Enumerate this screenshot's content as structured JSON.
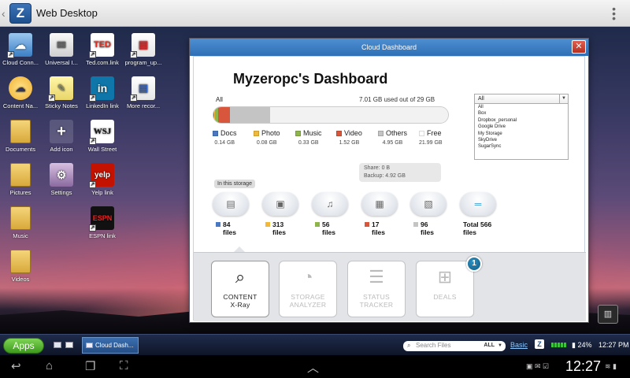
{
  "appbar": {
    "logo": "Z",
    "title": "Web Desktop",
    "overflow_icon": "overflow-menu-icon"
  },
  "desktop_icons": [
    {
      "label": "Cloud Conn...",
      "icon": "cloud-connect-icon"
    },
    {
      "label": "Universal I...",
      "icon": "universal-inbox-icon"
    },
    {
      "label": "Ted.com.link",
      "icon": "ted-link-icon",
      "text": "TED"
    },
    {
      "label": "program_up...",
      "icon": "document-icon"
    },
    {
      "label": "Content Na...",
      "icon": "content-navigator-icon"
    },
    {
      "label": "Sticky Notes",
      "icon": "sticky-notes-icon"
    },
    {
      "label": "LinkedIn link",
      "icon": "linkedin-icon",
      "text": "in"
    },
    {
      "label": "More recor...",
      "icon": "document-icon"
    },
    {
      "label": "Documents",
      "icon": "folder-icon"
    },
    {
      "label": "Add icon",
      "icon": "add-icon",
      "text": "+"
    },
    {
      "label": "Wall Street",
      "icon": "wsj-icon",
      "text": "WSJ"
    },
    {
      "label": "Pictures",
      "icon": "folder-icon"
    },
    {
      "label": "Settings",
      "icon": "settings-icon"
    },
    {
      "label": "Yelp link",
      "icon": "yelp-icon",
      "text": "yelp"
    },
    {
      "label": "Music",
      "icon": "folder-icon"
    },
    {
      "label": "ESPN link",
      "icon": "espn-icon",
      "text": "ESPN"
    },
    {
      "label": "Videos",
      "icon": "folder-icon"
    }
  ],
  "window": {
    "title": "Cloud Dashboard",
    "close_label": "✕",
    "heading": "Myzeropc's Dashboard",
    "scope_label": "All",
    "usage_text": "7.01 GB used out of 29 GB",
    "usage_bar": [
      {
        "name": "Docs",
        "fraction": 0.0048,
        "color": "#4a78c2"
      },
      {
        "name": "Photo",
        "fraction": 0.0028,
        "color": "#f0b93a"
      },
      {
        "name": "Music",
        "fraction": 0.0114,
        "color": "#8db54a"
      },
      {
        "name": "Video",
        "fraction": 0.0524,
        "color": "#d8573c"
      },
      {
        "name": "Others",
        "fraction": 0.1707,
        "color": "#c4c4c4"
      },
      {
        "name": "Free",
        "fraction": 0.7579,
        "color": "#f2f2f2"
      }
    ],
    "legend": [
      {
        "name": "Docs",
        "size": "0.14 GB",
        "color": "#4a78c2"
      },
      {
        "name": "Photo",
        "size": "0.08 GB",
        "color": "#f0b93a"
      },
      {
        "name": "Music",
        "size": "0.33 GB",
        "color": "#8db54a"
      },
      {
        "name": "Video",
        "size": "1.52 GB",
        "color": "#d8573c"
      },
      {
        "name": "Others",
        "size": "4.95 GB",
        "color": "#c4c4c4"
      },
      {
        "name": "Free",
        "size": "21.99 GB",
        "color": "#ffffff"
      }
    ],
    "share_line": "Share:        0 B",
    "backup_line": "Backup: 4.92 GB",
    "storage_select": {
      "selected": "All",
      "options": [
        "All",
        "Box",
        "Dropbox_personal",
        "Google Drive",
        "My Storage",
        "SkyDrive",
        "SugarSync"
      ]
    },
    "in_storage_label": "In this storage",
    "file_counts": [
      {
        "count": "84",
        "unit": "files",
        "color": "#4a78c2",
        "icon": "docs-icon",
        "glyph": "▤"
      },
      {
        "count": "313",
        "unit": "files",
        "color": "#f0b93a",
        "icon": "photo-icon",
        "glyph": "▣"
      },
      {
        "count": "56",
        "unit": "files",
        "color": "#8db54a",
        "icon": "music-icon",
        "glyph": "♫"
      },
      {
        "count": "17",
        "unit": "files",
        "color": "#d8573c",
        "icon": "video-icon",
        "glyph": "▦"
      },
      {
        "count": "96",
        "unit": "files",
        "color": "#c4c4c4",
        "icon": "other-files-icon",
        "glyph": "▧"
      },
      {
        "count": "Total 566",
        "unit": "files",
        "color": "",
        "icon": "total-icon",
        "glyph": "═"
      }
    ],
    "tools": [
      {
        "label1": "CONTENT",
        "label2": "X-Ray",
        "icon": "content-xray-icon",
        "active": true
      },
      {
        "label1": "STORAGE",
        "label2": "ANALYZER",
        "icon": "storage-analyzer-icon",
        "active": false
      },
      {
        "label1": "STATUS",
        "label2": "TRACKER",
        "icon": "status-tracker-icon",
        "active": false
      },
      {
        "label1": "DEALS",
        "label2": "",
        "icon": "deals-icon",
        "active": false
      }
    ],
    "deals_badge": "1"
  },
  "taskbar": {
    "apps_label": "Apps",
    "task_label": "Cloud Dash...",
    "search_placeholder": "Search Files",
    "search_scope": "ALL",
    "basic_label": "Basic",
    "battery": "24%",
    "time": "12:27 PM"
  },
  "sysbar": {
    "clock": "12:27"
  }
}
